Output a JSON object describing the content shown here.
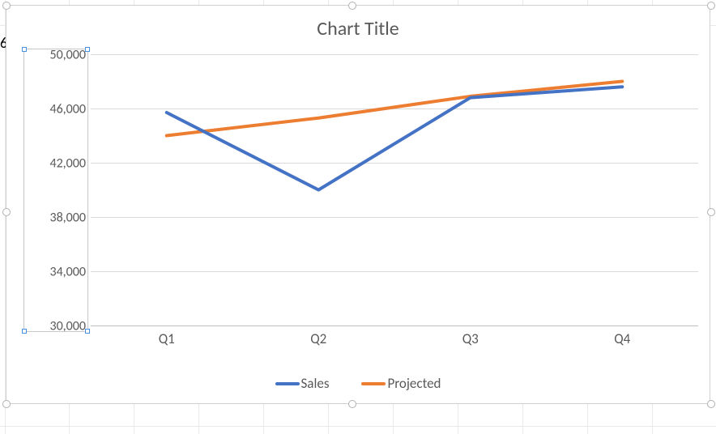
{
  "chart_data": {
    "type": "line",
    "title": "Chart Title",
    "categories": [
      "Q1",
      "Q2",
      "Q3",
      "Q4"
    ],
    "series": [
      {
        "name": "Sales",
        "values": [
          45700,
          40000,
          46800,
          47600
        ],
        "color": "#4472C4"
      },
      {
        "name": "Projected",
        "values": [
          44000,
          45300,
          46900,
          48000
        ],
        "color": "#ED7D31"
      }
    ],
    "ylim": [
      30000,
      50000
    ],
    "ytick_interval": 4000,
    "ytick_labels": [
      "30,000",
      "34,000",
      "38,000",
      "42,000",
      "46,000",
      "50,000"
    ],
    "xlabel": "",
    "ylabel": ""
  },
  "legend": {
    "sales": "Sales",
    "projected": "Projected"
  },
  "ui": {
    "chart_selected": true,
    "yaxis_selected": true,
    "edge_char": "6"
  }
}
